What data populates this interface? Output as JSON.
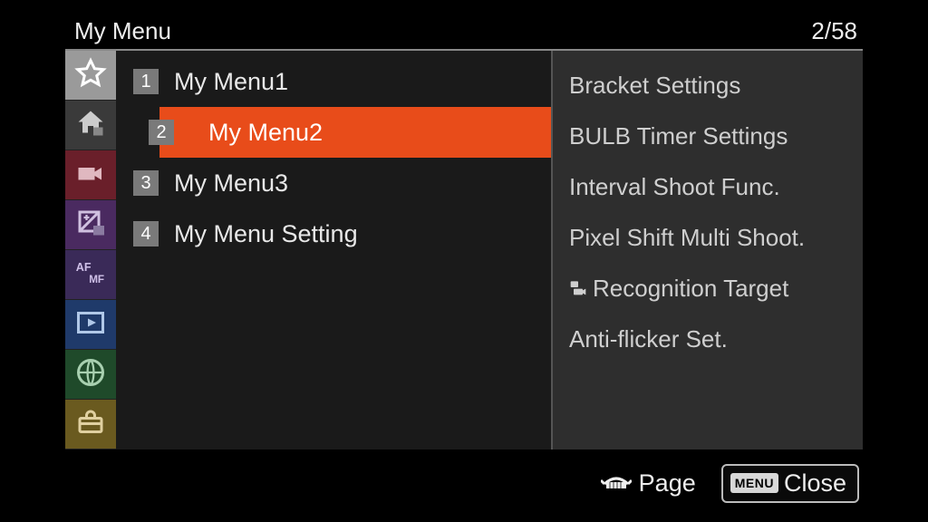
{
  "header": {
    "title": "My Menu",
    "page_indicator": "2/58"
  },
  "sidebar": {
    "tabs": [
      {
        "id": "star",
        "label": "My Menu"
      },
      {
        "id": "home",
        "label": "Main"
      },
      {
        "id": "video",
        "label": "Shooting"
      },
      {
        "id": "expo",
        "label": "Exposure"
      },
      {
        "id": "afmf",
        "label": "Focus"
      },
      {
        "id": "play",
        "label": "Playback"
      },
      {
        "id": "globe",
        "label": "Network"
      },
      {
        "id": "toolbox",
        "label": "Setup"
      }
    ]
  },
  "left_menu": {
    "items": [
      {
        "num": "1",
        "label": "My Menu1",
        "selected": false
      },
      {
        "num": "2",
        "label": "My Menu2",
        "selected": true
      },
      {
        "num": "3",
        "label": "My Menu3",
        "selected": false
      },
      {
        "num": "4",
        "label": "My Menu Setting",
        "selected": false
      }
    ]
  },
  "right_menu": {
    "items": [
      {
        "label": "Bracket Settings",
        "icon": null
      },
      {
        "label": "BULB Timer Settings",
        "icon": null
      },
      {
        "label": "Interval Shoot Func.",
        "icon": null
      },
      {
        "label": "Pixel Shift Multi Shoot.",
        "icon": null
      },
      {
        "label": "Recognition Target",
        "icon": "camera-movie"
      },
      {
        "label": "Anti-flicker Set.",
        "icon": null
      }
    ]
  },
  "footer": {
    "page_label": "Page",
    "close_label": "Close",
    "menu_pill": "MENU"
  }
}
